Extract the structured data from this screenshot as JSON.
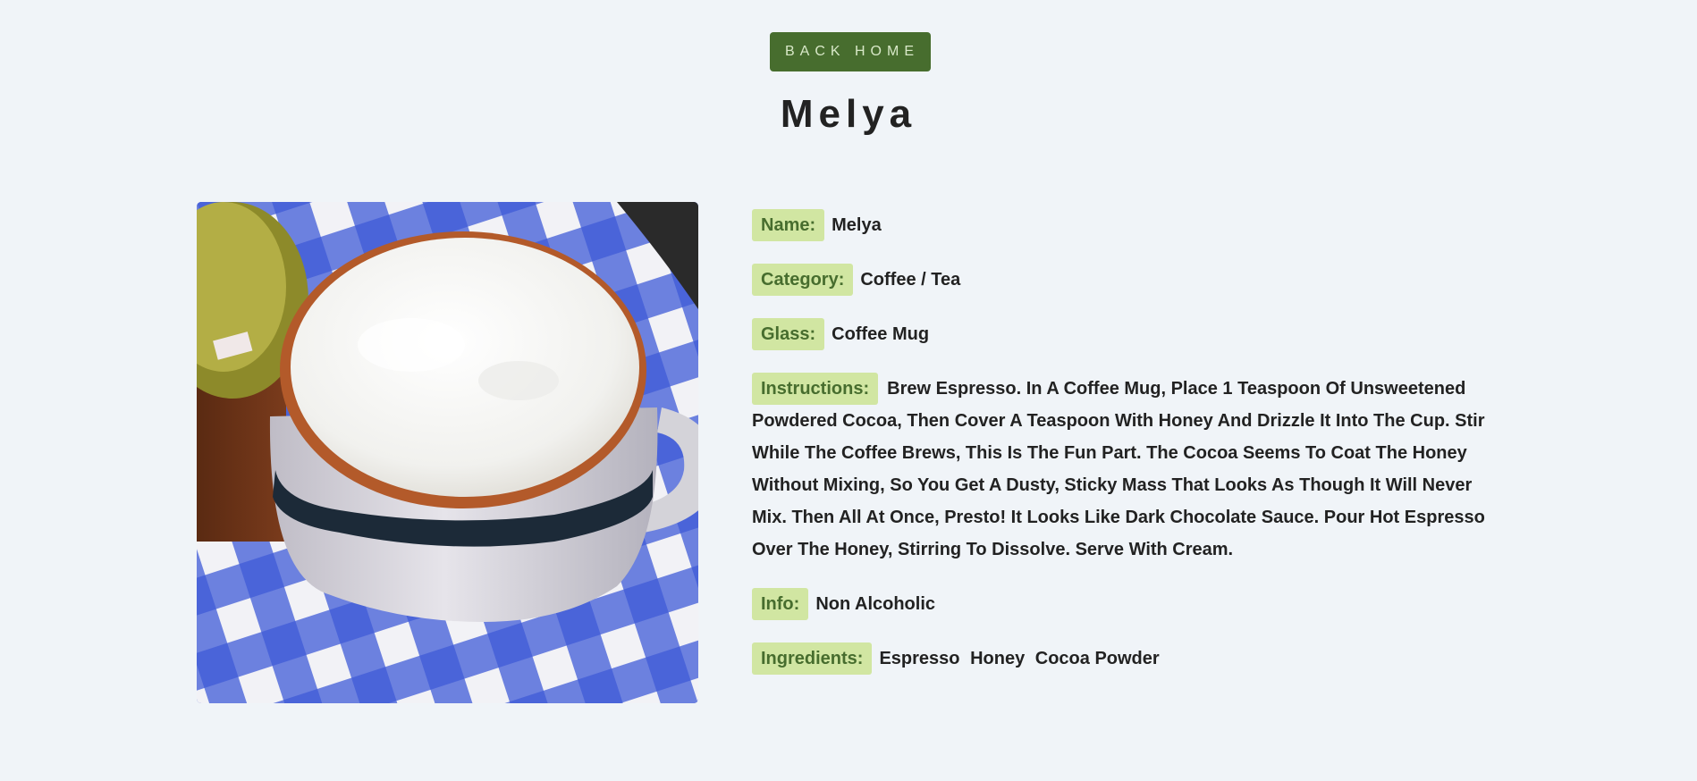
{
  "back_button": {
    "label": "Back Home"
  },
  "title": "Melya",
  "photo": {
    "alt": "Melya",
    "colors": {
      "cloth_blue": "#2d48c8",
      "cloth_white": "#f2f2f6",
      "foam": "#f7f7f4",
      "rim": "#b35a2a",
      "mug": "#d9d8dc",
      "band": "#1c2a38"
    }
  },
  "details": {
    "name": {
      "label": "Name:",
      "value": "Melya"
    },
    "category": {
      "label": "Category:",
      "value": "Coffee / Tea"
    },
    "glass": {
      "label": "Glass:",
      "value": "Coffee Mug"
    },
    "instructions": {
      "label": "Instructions:",
      "value": "Brew Espresso. In A Coffee Mug, Place 1 Teaspoon Of Unsweetened Powdered Cocoa, Then Cover A Teaspoon With Honey And Drizzle It Into The Cup. Stir While The Coffee Brews, This Is The Fun Part. The Cocoa Seems To Coat The Honey Without Mixing, So You Get A Dusty, Sticky Mass That Looks As Though It Will Never Mix. Then All At Once, Presto! It Looks Like Dark Chocolate Sauce. Pour Hot Espresso Over The Honey, Stirring To Dissolve. Serve With Cream."
    },
    "info": {
      "label": "Info:",
      "value": "Non Alcoholic"
    },
    "ingredients": {
      "label": "Ingredients:",
      "items": [
        "Espresso",
        "Honey",
        "Cocoa Powder"
      ]
    }
  },
  "colors": {
    "accent": "#476d2e",
    "label_bg": "#d1e6a2",
    "page_bg": "#f0f4f8"
  }
}
